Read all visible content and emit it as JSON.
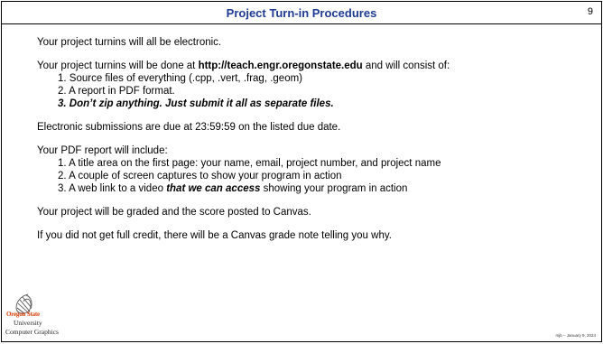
{
  "slide": {
    "title": "Project Turn-in Procedures",
    "page_number": "9",
    "footer": "mjb – January 9, 2024"
  },
  "content": {
    "p1": "Your project turnins will all be electronic.",
    "p2_prefix": "Your project turnins will be done at ",
    "p2_url": "http://teach.engr.oregonstate.edu",
    "p2_suffix": " and will consist of:",
    "list1": [
      "1. Source files of everything (.cpp, .vert, .frag, .geom)",
      "2. A report in PDF format.",
      "3. Don’t zip anything.  Just submit it all as separate files."
    ],
    "p3": "Electronic submissions are due at 23:59:59 on the listed due date.",
    "p4": "Your PDF report will include:",
    "list2": [
      "1. A title area on the first page: your name, email, project number, and project name",
      "2. A couple of screen captures to show your program in action"
    ],
    "list2_item3_prefix": "3. A web link to a video ",
    "list2_item3_emph": "that we can access",
    "list2_item3_suffix": " showing your program in action",
    "p5": "Your project will be graded and the score posted to Canvas.",
    "p6": "If you did not get full credit, there will be a Canvas grade note telling you why."
  },
  "logo": {
    "line1": "Oregon State",
    "line2": "University",
    "line3": "Computer Graphics"
  }
}
